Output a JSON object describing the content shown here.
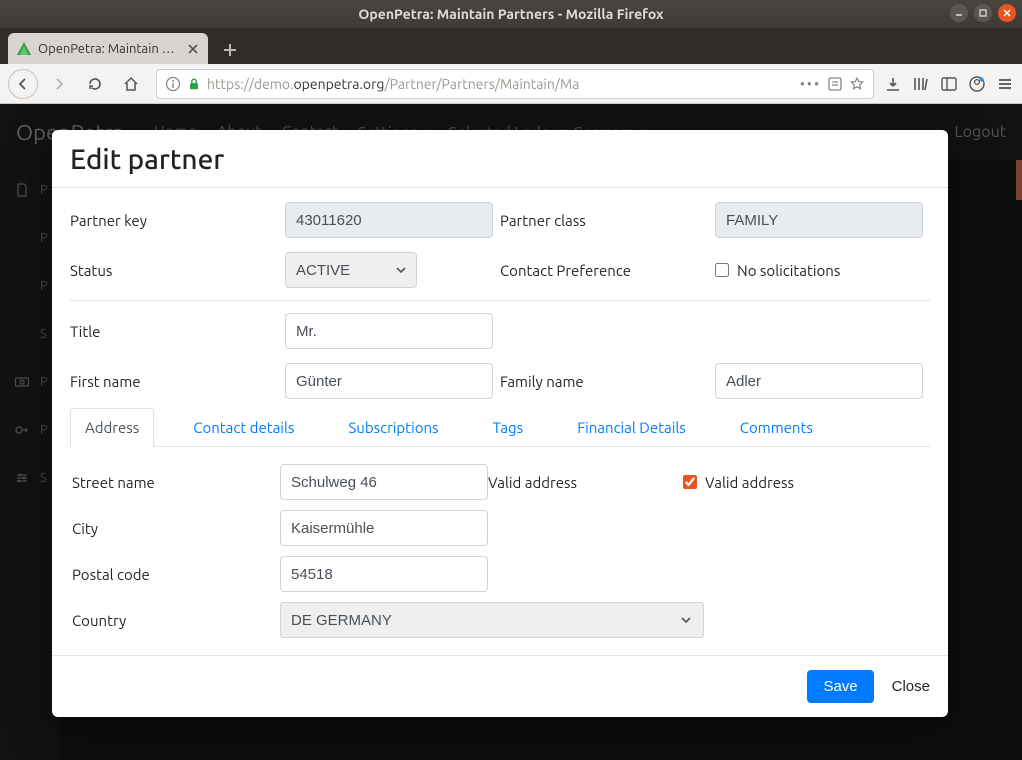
{
  "window": {
    "title": "OpenPetra: Maintain Partners - Mozilla Firefox"
  },
  "tabstrip": {
    "label": "OpenPetra: Maintain Par"
  },
  "urlbar": {
    "scheme": "https://",
    "sub": "demo.",
    "host": "openpetra.org",
    "path": "/Partner/Partners/Maintain/Ma"
  },
  "navbar": {
    "brand": "OpenPetra",
    "items": [
      "Home",
      "About",
      "Contact",
      "Settings ▾",
      "Selected Ledger: Germany ▾"
    ],
    "logout": "Logout"
  },
  "sidebar": {
    "items": [
      {
        "icon": "file",
        "label": "P"
      },
      {
        "icon": "",
        "label": "P"
      },
      {
        "icon": "",
        "label": "P"
      },
      {
        "icon": "",
        "label": "S"
      },
      {
        "icon": "cash",
        "label": "P"
      },
      {
        "icon": "key",
        "label": "P"
      },
      {
        "icon": "sliders",
        "label": "S"
      }
    ]
  },
  "modal": {
    "title": "Edit partner",
    "labels": {
      "partner_key": "Partner key",
      "partner_class": "Partner class",
      "status": "Status",
      "contact_pref": "Contact Preference",
      "no_solicit": "No solicitations",
      "title": "Title",
      "first_name": "First name",
      "family_name": "Family name"
    },
    "values": {
      "partner_key": "43011620",
      "partner_class": "FAMILY",
      "status": "ACTIVE",
      "no_solicit": false,
      "title": "Mr.",
      "first_name": "Günter",
      "family_name": "Adler"
    },
    "tabs": [
      "Address",
      "Contact details",
      "Subscriptions",
      "Tags",
      "Financial Details",
      "Comments"
    ],
    "address": {
      "labels": {
        "street": "Street name",
        "valid_label": "Valid address",
        "valid_check": "Valid address",
        "city": "City",
        "postal": "Postal code",
        "country": "Country"
      },
      "values": {
        "street": "Schulweg 46",
        "valid": true,
        "city": "Kaisermühle",
        "postal": "54518",
        "country": "DE GERMANY"
      }
    },
    "footer": {
      "save": "Save",
      "close": "Close"
    }
  }
}
